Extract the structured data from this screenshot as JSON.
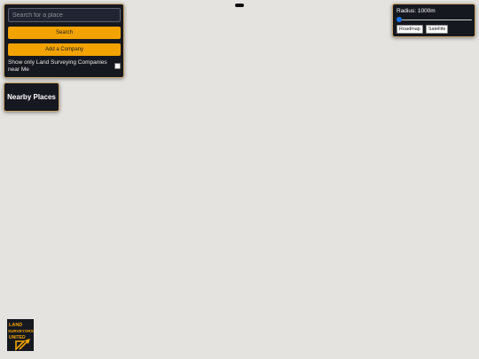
{
  "search": {
    "placeholder": "Search for a place",
    "search_button": "Search",
    "add_company_button": "Add a Company",
    "filter_label": "Show only Land Surveying Companies near Me",
    "filter_checked": false
  },
  "nearby": {
    "title": "Nearby Places"
  },
  "radius": {
    "label": "Radius: 1000m",
    "slider_fraction": 0.02,
    "map_types": [
      "Roadmap",
      "Satellite"
    ]
  },
  "logo": {
    "lines": [
      "LAND",
      "SURVEYORS",
      "UNITED"
    ]
  },
  "colors": {
    "panel_bg": "#16181f",
    "accent_orange": "#f2a300",
    "map_bg": "#e5e3df",
    "slider_blue": "#1a73e8"
  }
}
